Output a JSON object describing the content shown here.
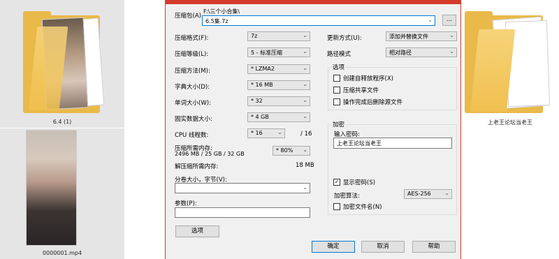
{
  "explorer": {
    "items": [
      {
        "name": "6.4 (1)"
      },
      {
        "name": "0000001.mp4"
      },
      {
        "name": "上老王论坛当老王"
      }
    ]
  },
  "dialog": {
    "archive_label": "压缩包(A)",
    "archive_path": "F:\\三个小合集\\",
    "archive_name": "6.5集.7z",
    "browse_label": "...",
    "format_label": "压缩格式(F):",
    "format_value": "7z",
    "level_label": "压缩等级(L):",
    "level_value": "5 - 标准压缩",
    "method_label": "压缩方法(M):",
    "method_value": "* LZMA2",
    "dict_label": "字典大小(D):",
    "dict_value": "* 16 MB",
    "word_label": "单词大小(W):",
    "word_value": "* 32",
    "solid_label": "固实数据大小:",
    "solid_value": "* 4 GB",
    "cpu_label": "CPU 线程数:",
    "cpu_value": "* 16",
    "cpu_total": "/ 16",
    "mem_label": "压缩所需内存:",
    "mem_detail": "2496 MB / 25 GB / 32 GB",
    "mem_percent": "* 80%",
    "decomp_label": "解压缩所需内存:",
    "decomp_value": "18 MB",
    "split_label": "分卷大小，字节(V):",
    "split_value": "",
    "params_label": "参数(P):",
    "params_value": "",
    "options_button": "选项",
    "update_label": "更新方式(U):",
    "update_value": "添加并替换文件",
    "path_label": "路径模式",
    "path_value": "相对路径",
    "options_group": {
      "title": "选项",
      "items": [
        {
          "label": "创建自释放程序(X)",
          "checked": false
        },
        {
          "label": "压缩共享文件",
          "checked": false
        },
        {
          "label": "操作完成后删除源文件",
          "checked": false
        }
      ]
    },
    "encryption": {
      "title": "加密",
      "password_label": "输入密码:",
      "password_value": "上老王论坛当老王",
      "show_password_label": "显示密码(S)",
      "show_password_checked": true,
      "show_password_mark": "✓",
      "algo_label": "加密算法:",
      "algo_value": "AES-256",
      "encrypt_names_label": "加密文件名(N)",
      "encrypt_names_checked": false
    },
    "ok_button": "确定",
    "cancel_button": "取消",
    "help_button": "帮助"
  },
  "colors": {
    "titlebar": "#d43b2c",
    "focus_border": "#0078d7",
    "folder": "#f0c04f"
  }
}
